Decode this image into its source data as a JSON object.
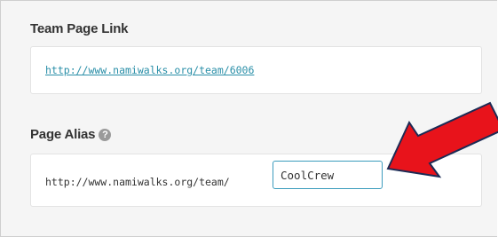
{
  "team_link": {
    "title": "Team Page Link",
    "url": "http://www.namiwalks.org/team/6006"
  },
  "alias": {
    "title": "Page Alias",
    "help_icon": "help-question-icon",
    "help_glyph": "?",
    "prefix": "http://www.namiwalks.org/team/",
    "value": "CoolCrew"
  },
  "annotation": {
    "arrow_color": "#e8131b",
    "arrow_outline": "#1c2b55"
  }
}
